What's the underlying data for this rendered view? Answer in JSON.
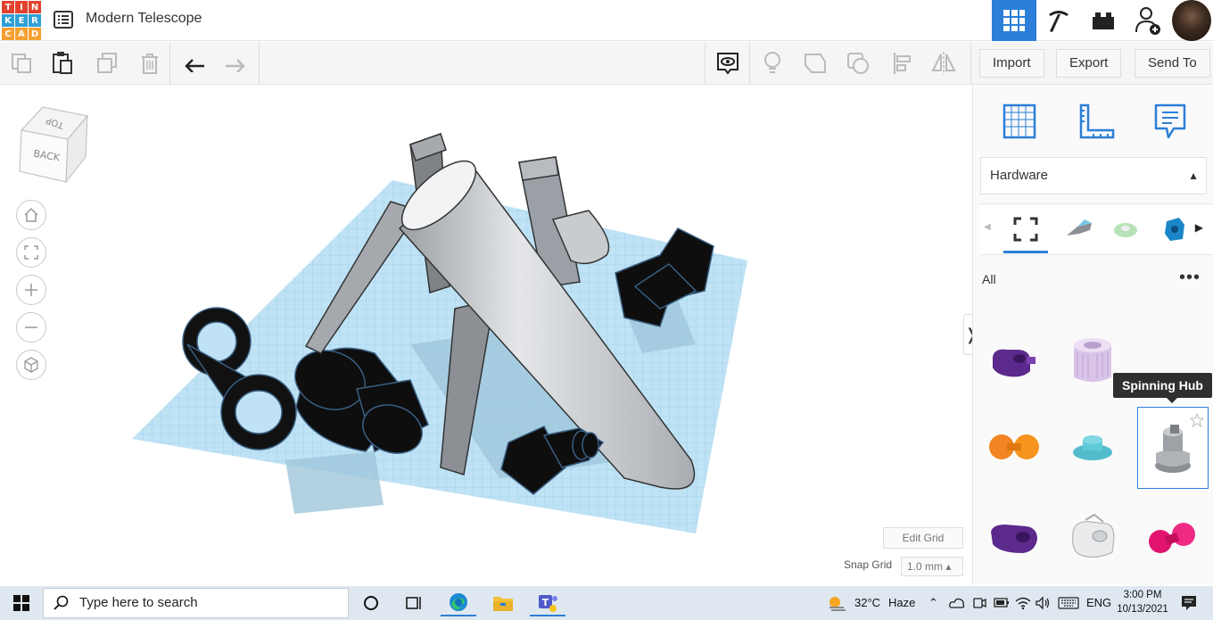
{
  "app": {
    "logo_letters": [
      "T",
      "I",
      "N",
      "K",
      "E",
      "R",
      "C",
      "A",
      "D"
    ],
    "logo_colors": [
      "#e2412e",
      "#e2412e",
      "#e2412e",
      "#2f9fd7",
      "#2f9fd7",
      "#2f9fd7",
      "#f7a030",
      "#f7a030",
      "#f7a030"
    ],
    "project_title": "Modern Telescope",
    "accent": "#2b7fd8"
  },
  "header": {
    "buttons": [
      "3d-design-view",
      "codeblocks",
      "bricks",
      "add-user"
    ]
  },
  "toolbar": {
    "import_label": "Import",
    "export_label": "Export",
    "send_to_label": "Send To"
  },
  "viewcube": {
    "top": "TOP",
    "back": "BACK"
  },
  "workplane": {
    "edit_grid_label": "Edit Grid",
    "snap_grid_label": "Snap Grid",
    "snap_grid_value": "1.0 mm ▴"
  },
  "panel": {
    "library": "Hardware",
    "filter_label": "All",
    "more": "•••",
    "tooltip": "Spinning Hub",
    "shapes": [
      "purple-clip",
      "lilac-spool",
      "spinning-hub",
      "orange-dumbbell",
      "teal-cap",
      "spinning-hub-gray",
      "purple-clip-2",
      "white-clip",
      "magenta-dumbbell"
    ]
  },
  "taskbar": {
    "search_placeholder": "Type here to search",
    "weather_temp": "32°C",
    "weather_text": "Haze",
    "language": "ENG",
    "time": "3:00 PM",
    "date": "10/13/2021"
  }
}
